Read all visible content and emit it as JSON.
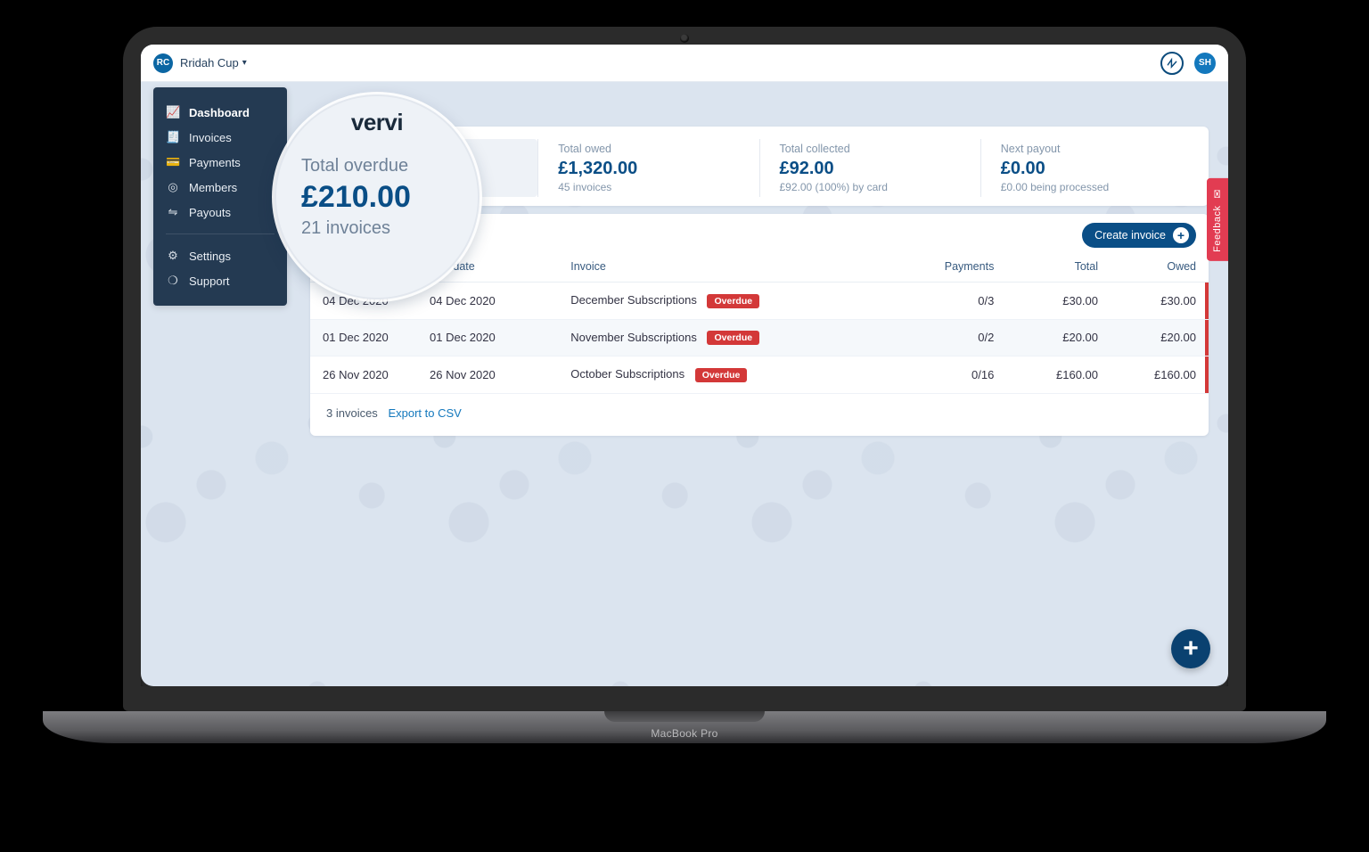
{
  "header": {
    "org_initials": "RC",
    "org_name": "Rridah Cup",
    "user_initials": "SH",
    "page_title_fragment": "vervi"
  },
  "sidebar": {
    "items": [
      {
        "label": "Dashboard",
        "icon": "chart",
        "active": true
      },
      {
        "label": "Invoices",
        "icon": "doc"
      },
      {
        "label": "Payments",
        "icon": "card"
      },
      {
        "label": "Members",
        "icon": "user"
      },
      {
        "label": "Payouts",
        "icon": "stack"
      }
    ],
    "secondary": [
      {
        "label": "Settings",
        "icon": "gear"
      },
      {
        "label": "Support",
        "icon": "life"
      }
    ]
  },
  "stats": {
    "overdue": {
      "label": "Total overdue",
      "value": "£210.00",
      "sub": "21 invoices"
    },
    "owed": {
      "label": "Total owed",
      "value": "£1,320.00",
      "sub": "45 invoices"
    },
    "collected": {
      "label": "Total collected",
      "value": "£92.00",
      "sub": "£92.00 (100%) by card"
    },
    "payout": {
      "label": "Next payout",
      "value": "£0.00",
      "sub": "£0.00 being processed"
    }
  },
  "invoices": {
    "create_label": "Create invoice",
    "columns": {
      "due": "Due date",
      "invoice": "Invoice",
      "payments": "Payments",
      "total": "Total",
      "owed": "Owed"
    },
    "rows": [
      {
        "date": "04 Dec 2020",
        "due": "04 Dec 2020",
        "name": "December Subscriptions",
        "badge": "Overdue",
        "payments": "0/3",
        "total": "£30.00",
        "owed": "£30.00"
      },
      {
        "date": "01 Dec 2020",
        "due": "01 Dec 2020",
        "name": "November Subscriptions",
        "badge": "Overdue",
        "payments": "0/2",
        "total": "£20.00",
        "owed": "£20.00"
      },
      {
        "date": "26 Nov 2020",
        "due": "26 Nov 2020",
        "name": "October Subscriptions",
        "badge": "Overdue",
        "payments": "0/16",
        "total": "£160.00",
        "owed": "£160.00"
      }
    ],
    "footer_count": "3 invoices",
    "footer_link": "Export to CSV"
  },
  "feedback_label": "Feedback",
  "laptop_label": "MacBook Pro"
}
